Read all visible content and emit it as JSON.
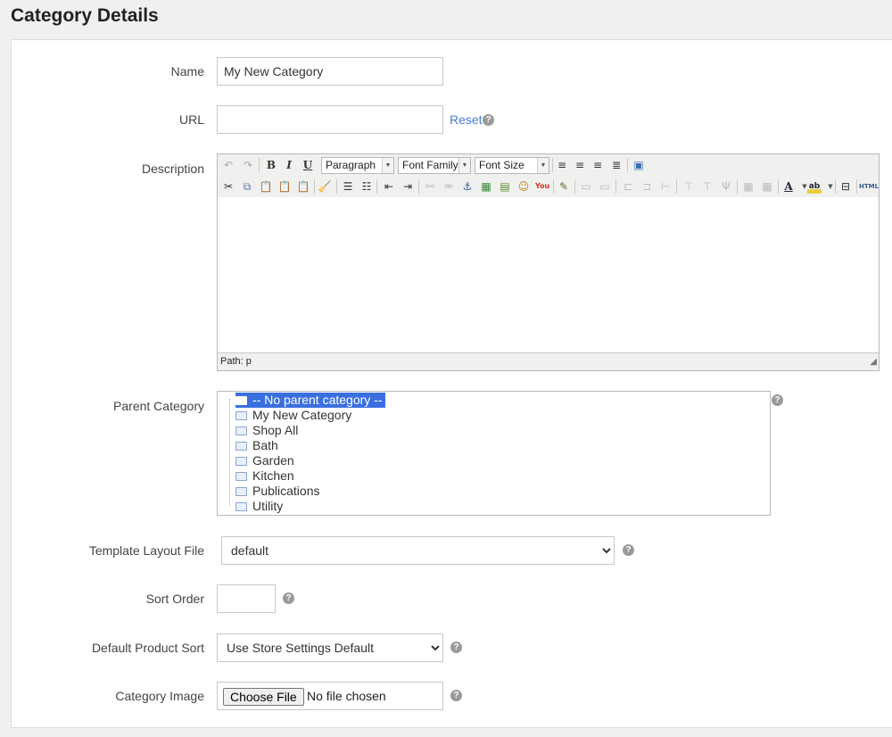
{
  "page": {
    "title": "Category Details"
  },
  "form": {
    "name": {
      "label": "Name",
      "value": "My New Category"
    },
    "url": {
      "label": "URL",
      "value": "",
      "reset_label": "Reset"
    },
    "description": {
      "label": "Description",
      "format_select": "Paragraph",
      "font_family_select": "Font Family",
      "font_size_select": "Font Size",
      "status_path": "Path: p"
    },
    "parent_category": {
      "label": "Parent Category",
      "items": [
        "-- No parent category --",
        "My New Category",
        "Shop All",
        "Bath",
        "Garden",
        "Kitchen",
        "Publications",
        "Utility"
      ],
      "selected_index": 0
    },
    "template_layout": {
      "label": "Template Layout File",
      "value": "default"
    },
    "sort_order": {
      "label": "Sort Order",
      "value": ""
    },
    "default_product_sort": {
      "label": "Default Product Sort",
      "value": "Use Store Settings Default"
    },
    "category_image": {
      "label": "Category Image",
      "button_label": "Choose File",
      "status": "No file chosen"
    }
  },
  "icons": {
    "help": "?",
    "help_color": "#9a9a9a",
    "accent": "#4a7cd6",
    "selection": "#3a6fe0"
  }
}
